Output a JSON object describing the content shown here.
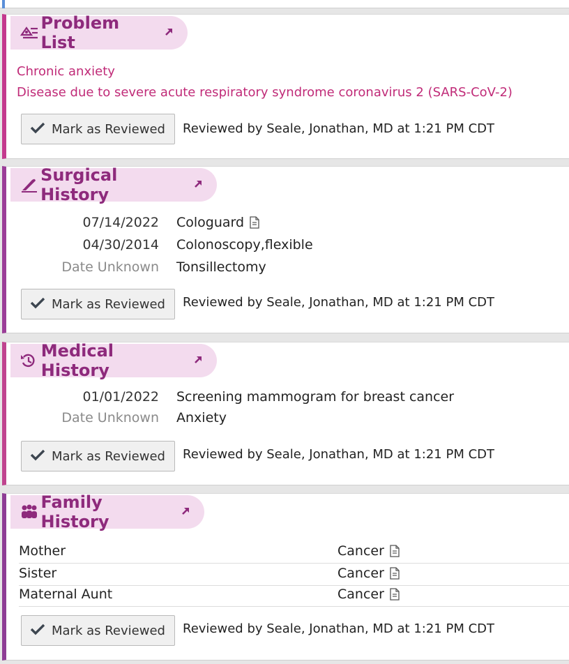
{
  "problem_list": {
    "title": "Problem List",
    "items": [
      "Chronic anxiety",
      "Disease due to severe acute respiratory syndrome coronavirus 2 (SARS-CoV-2)"
    ],
    "button_label": "Mark as Reviewed",
    "reviewed_text": "Reviewed by Seale, Jonathan, MD at 1:21 PM CDT"
  },
  "surgical_history": {
    "title": "Surgical History",
    "rows": [
      {
        "date": "07/14/2022",
        "procedure": "Cologuard",
        "has_note": true
      },
      {
        "date": "04/30/2014",
        "procedure": "Colonoscopy,flexible",
        "has_note": false
      },
      {
        "date": "Date Unknown",
        "procedure": "Tonsillectomy",
        "has_note": false
      }
    ],
    "button_label": "Mark as Reviewed",
    "reviewed_text": "Reviewed by Seale, Jonathan, MD at 1:21 PM CDT"
  },
  "medical_history": {
    "title": "Medical History",
    "rows": [
      {
        "date": "01/01/2022",
        "diagnosis": "Screening mammogram for breast cancer"
      },
      {
        "date": "Date Unknown",
        "diagnosis": "Anxiety"
      }
    ],
    "button_label": "Mark as Reviewed",
    "reviewed_text": "Reviewed by Seale, Jonathan, MD at 1:21 PM CDT"
  },
  "family_history": {
    "title": "Family History",
    "rows": [
      {
        "relation": "Mother",
        "condition": "Cancer"
      },
      {
        "relation": "Sister",
        "condition": "Cancer"
      },
      {
        "relation": "Maternal Aunt",
        "condition": "Cancer"
      }
    ],
    "button_label": "Mark as Reviewed",
    "reviewed_text": "Reviewed by Seale, Jonathan, MD at 1:21 PM CDT"
  },
  "colors": {
    "header_text": "#8e2a7c",
    "header_bg": "#f3dbee",
    "problem_text": "#c02b78"
  },
  "icons": {
    "problem_list": "problem-list-icon",
    "surgical_history": "scalpel-icon",
    "medical_history": "history-clock-icon",
    "family_history": "family-icon",
    "header_link": "external-link-arrow-icon",
    "note": "document-icon",
    "checkmark": "checkmark-icon"
  }
}
